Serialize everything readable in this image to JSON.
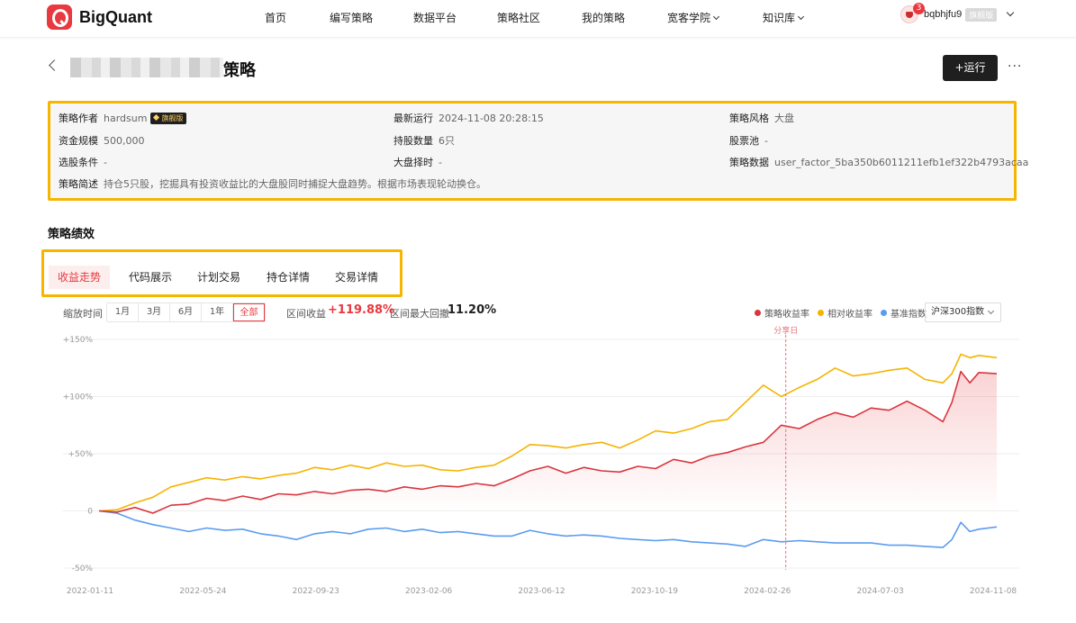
{
  "nav": {
    "logo_text": "BigQuant",
    "items": [
      {
        "label": "首页",
        "has_caret": false
      },
      {
        "label": "编写策略",
        "has_caret": false
      },
      {
        "label": "数据平台",
        "has_caret": false
      },
      {
        "label": "策略社区",
        "has_caret": false
      },
      {
        "label": "我的策略",
        "has_caret": false
      },
      {
        "label": "宽客学院",
        "has_caret": true
      },
      {
        "label": "知识库",
        "has_caret": true
      }
    ],
    "notification_count": "3",
    "user_name": "bqbhjfu9",
    "user_tag": "旗舰版"
  },
  "header": {
    "title": "策略",
    "run_button": "+运行",
    "more": "···"
  },
  "info": {
    "author_label": "策略作者",
    "author_value": "hardsum",
    "author_badge": "旗舰版",
    "last_run_label": "最新运行",
    "last_run_value": "2024-11-08 20:28:15",
    "style_label": "策略风格",
    "style_value": "大盘",
    "capital_label": "资金规模",
    "capital_value": "500,000",
    "holdings_label": "持股数量",
    "holdings_value": "6只",
    "pool_label": "股票池",
    "pool_value": "-",
    "filter_label": "选股条件",
    "filter_value": "-",
    "timing_label": "大盘择时",
    "timing_value": "-",
    "data_label": "策略数据",
    "data_value": "user_factor_5ba350b6011211efb1ef322b4793acaa",
    "desc_label": "策略简述",
    "desc_value": "持仓5只股，挖掘具有投资收益比的大盘股同时捕捉大盘趋势。根据市场表现轮动换仓。"
  },
  "performance": {
    "section_title": "策略绩效",
    "tabs": [
      "收益走势",
      "代码展示",
      "计划交易",
      "持仓详情",
      "交易详情"
    ],
    "active_tab": 0
  },
  "toolbar": {
    "zoom_label": "缩放时间",
    "ranges": [
      "1月",
      "3月",
      "6月",
      "1年",
      "全部"
    ],
    "active_range": 4,
    "interval_return_label": "区间收益",
    "interval_return_value": "+119.88%",
    "max_drawdown_label": "区间最大回撤",
    "max_drawdown_value": "11.20%",
    "benchmark_select": "沪深300指数"
  },
  "colors": {
    "strategy": "#d9363e",
    "relative": "#f5b400",
    "benchmark": "#5b9cf0",
    "share_line": "#e8737a"
  },
  "chart_data": {
    "type": "line",
    "x_ticks": [
      "2022-01-11",
      "2022-05-24",
      "2022-09-23",
      "2023-02-06",
      "2023-06-12",
      "2023-10-19",
      "2024-02-26",
      "2024-07-03",
      "2024-11-08"
    ],
    "y_ticks": [
      "+150%",
      "+100%",
      "+50%",
      "0",
      "-50%"
    ],
    "ylim": [
      -50,
      150
    ],
    "grid": true,
    "legend_position": "top-right",
    "annotation": {
      "label": "分享日",
      "x": 0.765
    },
    "series": [
      {
        "name": "策略收益率",
        "color_key": "strategy",
        "points": [
          [
            0,
            0
          ],
          [
            0.02,
            -1
          ],
          [
            0.04,
            3
          ],
          [
            0.06,
            -2
          ],
          [
            0.08,
            5
          ],
          [
            0.1,
            6
          ],
          [
            0.12,
            11
          ],
          [
            0.14,
            9
          ],
          [
            0.16,
            13
          ],
          [
            0.18,
            10
          ],
          [
            0.2,
            15
          ],
          [
            0.22,
            14
          ],
          [
            0.24,
            17
          ],
          [
            0.26,
            15
          ],
          [
            0.28,
            18
          ],
          [
            0.3,
            19
          ],
          [
            0.32,
            17
          ],
          [
            0.34,
            21
          ],
          [
            0.36,
            19
          ],
          [
            0.38,
            22
          ],
          [
            0.4,
            21
          ],
          [
            0.42,
            24
          ],
          [
            0.44,
            22
          ],
          [
            0.46,
            28
          ],
          [
            0.48,
            35
          ],
          [
            0.5,
            39
          ],
          [
            0.52,
            33
          ],
          [
            0.54,
            38
          ],
          [
            0.56,
            35
          ],
          [
            0.58,
            34
          ],
          [
            0.6,
            39
          ],
          [
            0.62,
            37
          ],
          [
            0.64,
            45
          ],
          [
            0.66,
            42
          ],
          [
            0.68,
            48
          ],
          [
            0.7,
            51
          ],
          [
            0.72,
            56
          ],
          [
            0.74,
            60
          ],
          [
            0.76,
            75
          ],
          [
            0.78,
            72
          ],
          [
            0.8,
            80
          ],
          [
            0.82,
            86
          ],
          [
            0.84,
            82
          ],
          [
            0.86,
            90
          ],
          [
            0.88,
            88
          ],
          [
            0.9,
            96
          ],
          [
            0.92,
            88
          ],
          [
            0.94,
            78
          ],
          [
            0.95,
            95
          ],
          [
            0.96,
            122
          ],
          [
            0.97,
            112
          ],
          [
            0.98,
            121
          ],
          [
            1.0,
            120
          ]
        ]
      },
      {
        "name": "相对收益率",
        "color_key": "relative",
        "points": [
          [
            0,
            0
          ],
          [
            0.02,
            1
          ],
          [
            0.04,
            7
          ],
          [
            0.06,
            12
          ],
          [
            0.08,
            21
          ],
          [
            0.1,
            25
          ],
          [
            0.12,
            29
          ],
          [
            0.14,
            27
          ],
          [
            0.16,
            30
          ],
          [
            0.18,
            28
          ],
          [
            0.2,
            31
          ],
          [
            0.22,
            33
          ],
          [
            0.24,
            38
          ],
          [
            0.26,
            36
          ],
          [
            0.28,
            40
          ],
          [
            0.3,
            37
          ],
          [
            0.32,
            42
          ],
          [
            0.34,
            39
          ],
          [
            0.36,
            40
          ],
          [
            0.38,
            36
          ],
          [
            0.4,
            35
          ],
          [
            0.42,
            38
          ],
          [
            0.44,
            40
          ],
          [
            0.46,
            48
          ],
          [
            0.48,
            58
          ],
          [
            0.5,
            57
          ],
          [
            0.52,
            55
          ],
          [
            0.54,
            58
          ],
          [
            0.56,
            60
          ],
          [
            0.58,
            55
          ],
          [
            0.6,
            62
          ],
          [
            0.62,
            70
          ],
          [
            0.64,
            68
          ],
          [
            0.66,
            72
          ],
          [
            0.68,
            78
          ],
          [
            0.7,
            80
          ],
          [
            0.72,
            95
          ],
          [
            0.74,
            110
          ],
          [
            0.76,
            100
          ],
          [
            0.78,
            108
          ],
          [
            0.8,
            115
          ],
          [
            0.82,
            125
          ],
          [
            0.84,
            118
          ],
          [
            0.86,
            120
          ],
          [
            0.88,
            123
          ],
          [
            0.9,
            125
          ],
          [
            0.92,
            115
          ],
          [
            0.94,
            112
          ],
          [
            0.95,
            120
          ],
          [
            0.96,
            137
          ],
          [
            0.97,
            134
          ],
          [
            0.98,
            136
          ],
          [
            1.0,
            134
          ]
        ]
      },
      {
        "name": "基准指数",
        "color_key": "benchmark",
        "points": [
          [
            0,
            0
          ],
          [
            0.02,
            -2
          ],
          [
            0.04,
            -8
          ],
          [
            0.06,
            -12
          ],
          [
            0.08,
            -15
          ],
          [
            0.1,
            -18
          ],
          [
            0.12,
            -15
          ],
          [
            0.14,
            -17
          ],
          [
            0.16,
            -16
          ],
          [
            0.18,
            -20
          ],
          [
            0.2,
            -22
          ],
          [
            0.22,
            -25
          ],
          [
            0.24,
            -20
          ],
          [
            0.26,
            -18
          ],
          [
            0.28,
            -20
          ],
          [
            0.3,
            -16
          ],
          [
            0.32,
            -15
          ],
          [
            0.34,
            -18
          ],
          [
            0.36,
            -16
          ],
          [
            0.38,
            -19
          ],
          [
            0.4,
            -18
          ],
          [
            0.42,
            -20
          ],
          [
            0.44,
            -22
          ],
          [
            0.46,
            -22
          ],
          [
            0.48,
            -17
          ],
          [
            0.5,
            -20
          ],
          [
            0.52,
            -22
          ],
          [
            0.54,
            -21
          ],
          [
            0.56,
            -22
          ],
          [
            0.58,
            -24
          ],
          [
            0.6,
            -25
          ],
          [
            0.62,
            -26
          ],
          [
            0.64,
            -25
          ],
          [
            0.66,
            -27
          ],
          [
            0.68,
            -28
          ],
          [
            0.7,
            -29
          ],
          [
            0.72,
            -31
          ],
          [
            0.74,
            -25
          ],
          [
            0.76,
            -27
          ],
          [
            0.78,
            -26
          ],
          [
            0.8,
            -27
          ],
          [
            0.82,
            -28
          ],
          [
            0.84,
            -28
          ],
          [
            0.86,
            -28
          ],
          [
            0.88,
            -30
          ],
          [
            0.9,
            -30
          ],
          [
            0.92,
            -31
          ],
          [
            0.94,
            -32
          ],
          [
            0.95,
            -25
          ],
          [
            0.96,
            -10
          ],
          [
            0.97,
            -18
          ],
          [
            0.98,
            -16
          ],
          [
            1.0,
            -14
          ]
        ]
      }
    ]
  }
}
